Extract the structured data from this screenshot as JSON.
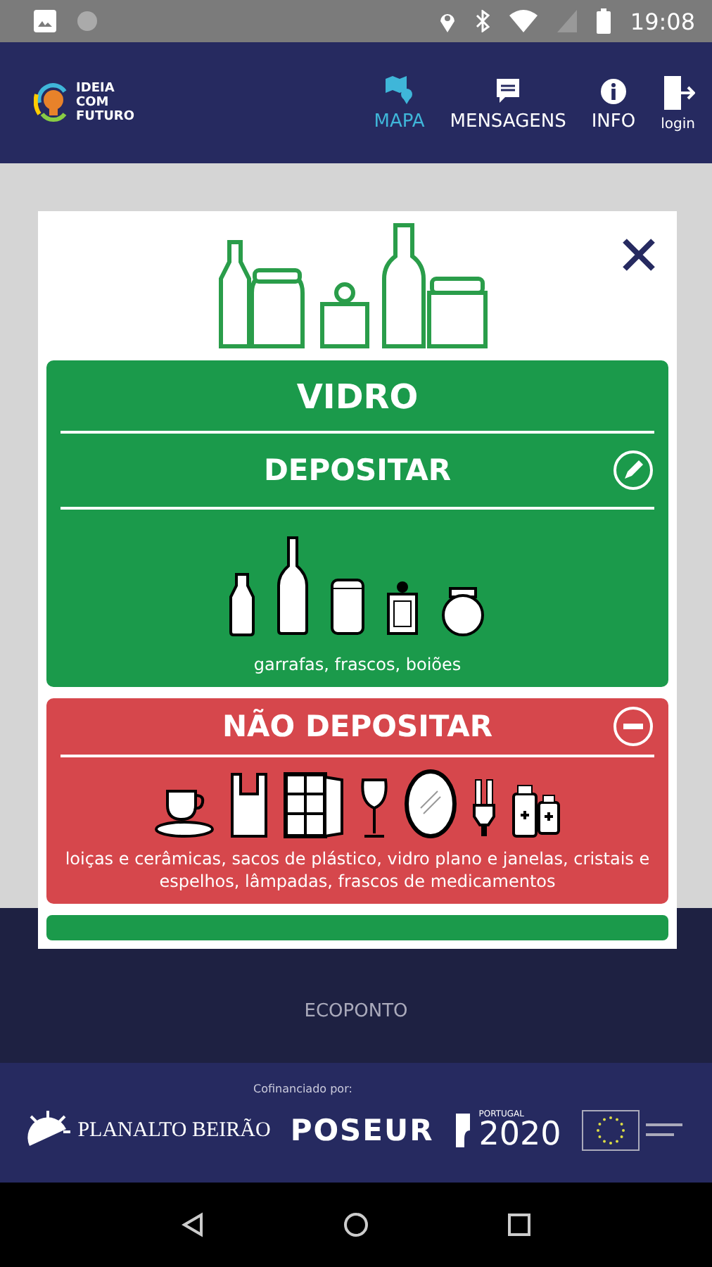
{
  "status_bar": {
    "time": "19:08"
  },
  "header": {
    "logo_lines": [
      "IDEIA",
      "COM",
      "FUTURO"
    ],
    "nav": [
      {
        "kind": "map",
        "label": "MAPA",
        "selected": true
      },
      {
        "kind": "messages",
        "label": "MENSAGENS",
        "selected": false
      },
      {
        "kind": "info",
        "label": "INFO",
        "selected": false
      },
      {
        "kind": "login",
        "label": "login",
        "selected": false
      }
    ]
  },
  "map": {
    "button_label": "ECOPONTO"
  },
  "modal": {
    "title": "VIDRO",
    "sections": [
      {
        "kind": "accept",
        "heading": "DEPOSITAR",
        "caption": "garrafas, frascos, boiões"
      },
      {
        "kind": "reject",
        "heading": "NÃO DEPOSITAR",
        "caption": "loiças e cerâmicas, sacos de plástico, vidro plano e janelas, cristais e espelhos, lâmpadas, frascos de medicamentos"
      }
    ]
  },
  "footer": {
    "label": "Cofinanciado por:",
    "partners": [
      {
        "kind": "planalto",
        "text": "PLANALTO BEIRÃO"
      },
      {
        "kind": "poseur",
        "text": "POSEUR"
      },
      {
        "kind": "portugal2020",
        "text": "2020",
        "subtext": "PORTUGAL"
      },
      {
        "kind": "eu"
      }
    ]
  }
}
